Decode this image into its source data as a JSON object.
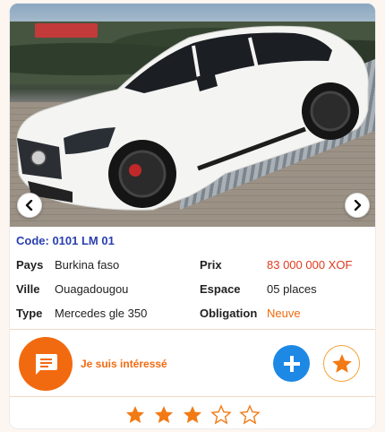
{
  "listing": {
    "code": "Code: 0101 LM 01",
    "details": {
      "pays_label": "Pays",
      "pays_value": "Burkina faso",
      "ville_label": "Ville",
      "ville_value": "Ouagadougou",
      "type_label": "Type",
      "type_value": "Mercedes gle 350",
      "prix_label": "Prix",
      "prix_value": "83 000 000 XOF",
      "espace_label": "Espace",
      "espace_value": "05 places",
      "obligation_label": "Obligation",
      "obligation_value": "Neuve"
    }
  },
  "actions": {
    "interested_label": "Je suis intéressé",
    "chat_icon": "chat-icon",
    "plus_icon": "plus-icon",
    "favorite_icon": "star-icon"
  },
  "rating": {
    "value": 3,
    "max": 5
  },
  "colors": {
    "accent_orange": "#f26a10",
    "price_red": "#e03a1e",
    "code_blue": "#2a3fb0",
    "plus_blue": "#1e88e5",
    "star_orange": "#f27a14"
  }
}
